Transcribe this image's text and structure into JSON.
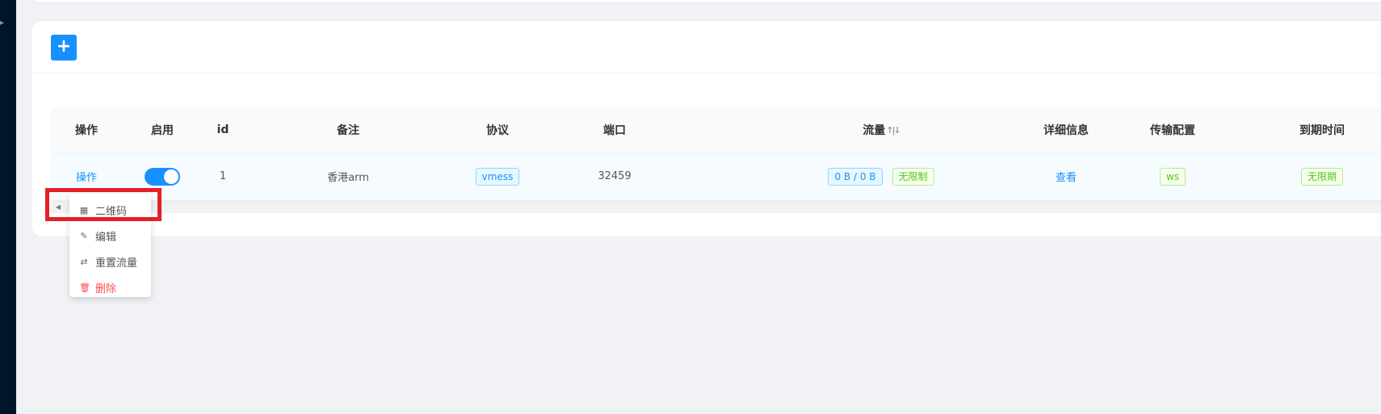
{
  "add_button": {
    "label": "+"
  },
  "table": {
    "headers": {
      "action": "操作",
      "enable": "启用",
      "id": "id",
      "remark": "备注",
      "protocol": "协议",
      "port": "端口",
      "traffic": "流量",
      "traffic_sort": "↑|↓",
      "details": "详细信息",
      "transport": "传输配置",
      "expiry": "到期时间"
    },
    "row": {
      "action": "操作",
      "enabled": true,
      "id": "1",
      "remark": "香港arm",
      "protocol": "vmess",
      "port": "32459",
      "traffic_usage": "0 B / 0 B",
      "traffic_limit": "无限制",
      "details": "查看",
      "transport": "ws",
      "expiry": "无限期"
    }
  },
  "dropdown_menu": {
    "items": [
      {
        "label": "二维码",
        "icon": "qrcode-icon"
      },
      {
        "label": "编辑",
        "icon": "edit-icon"
      },
      {
        "label": "重置流量",
        "icon": "retweet-icon"
      },
      {
        "label": "删除",
        "icon": "delete-icon"
      }
    ]
  },
  "colors": {
    "primary": "#1890ff",
    "success": "#52c41a",
    "danger": "#ff4d4f",
    "highlight": "#e51f26",
    "sidebar": "#001529"
  }
}
